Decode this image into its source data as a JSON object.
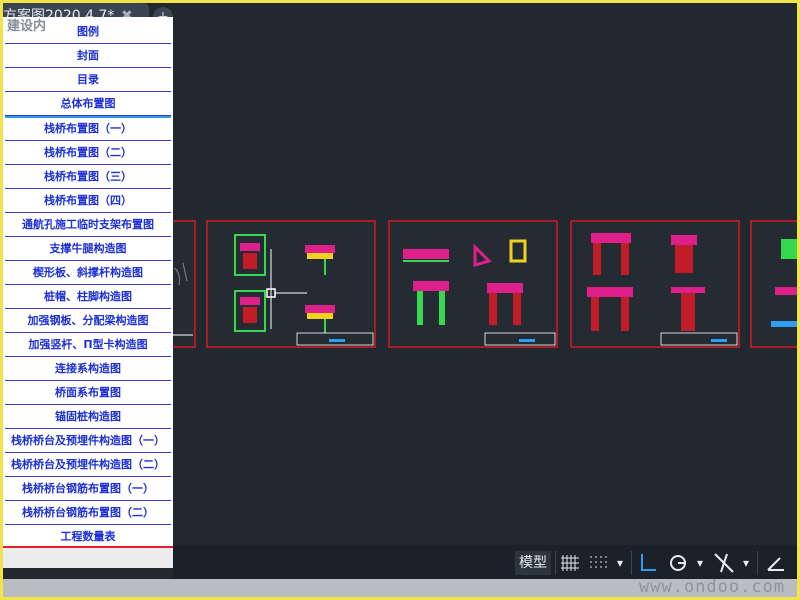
{
  "document_tab": {
    "title": "方案图2020.4.7*",
    "close_glyph": "✖",
    "new_tab_glyph": "+"
  },
  "sidebar": {
    "ghost_text": "建设内",
    "items": [
      "图例",
      "封面",
      "目录",
      "总体布置图",
      "栈桥布置图（一）",
      "栈桥布置图（二）",
      "栈桥布置图（三）",
      "栈桥布置图（四）",
      "通航孔施工临时支架布置图",
      "支撑牛腿构造图",
      "楔形板、斜撑杆构造图",
      "桩帽、柱脚构造图",
      "加强钢板、分配梁构造图",
      "加强竖杆、Π型卡构造图",
      "连接系构造图",
      "桥面系布置图",
      "锚固桩构造图",
      "栈桥桥台及预埋件构造图（一）",
      "栈桥桥台及预埋件构造图（二）",
      "栈桥桥台钢筋布置图（一）",
      "栈桥桥台钢筋布置图（二）",
      "工程数量表"
    ]
  },
  "statusbar": {
    "model_label": "模型",
    "grid_icon": "grid-icon",
    "snap_icon": "snap-icon",
    "ortho_icon": "ortho-icon",
    "polar_icon": "polar-icon",
    "osnap_icon": "object-snap-icon",
    "angle_icon": "angle-icon",
    "dropdown_glyph": "▾"
  },
  "watermark": "www.ondoo.com",
  "colors": {
    "accent_blue": "#2f9df0",
    "sheet_border": "#d11a22",
    "canvas_bg": "#212830",
    "panel_text": "#1d2fd6"
  }
}
